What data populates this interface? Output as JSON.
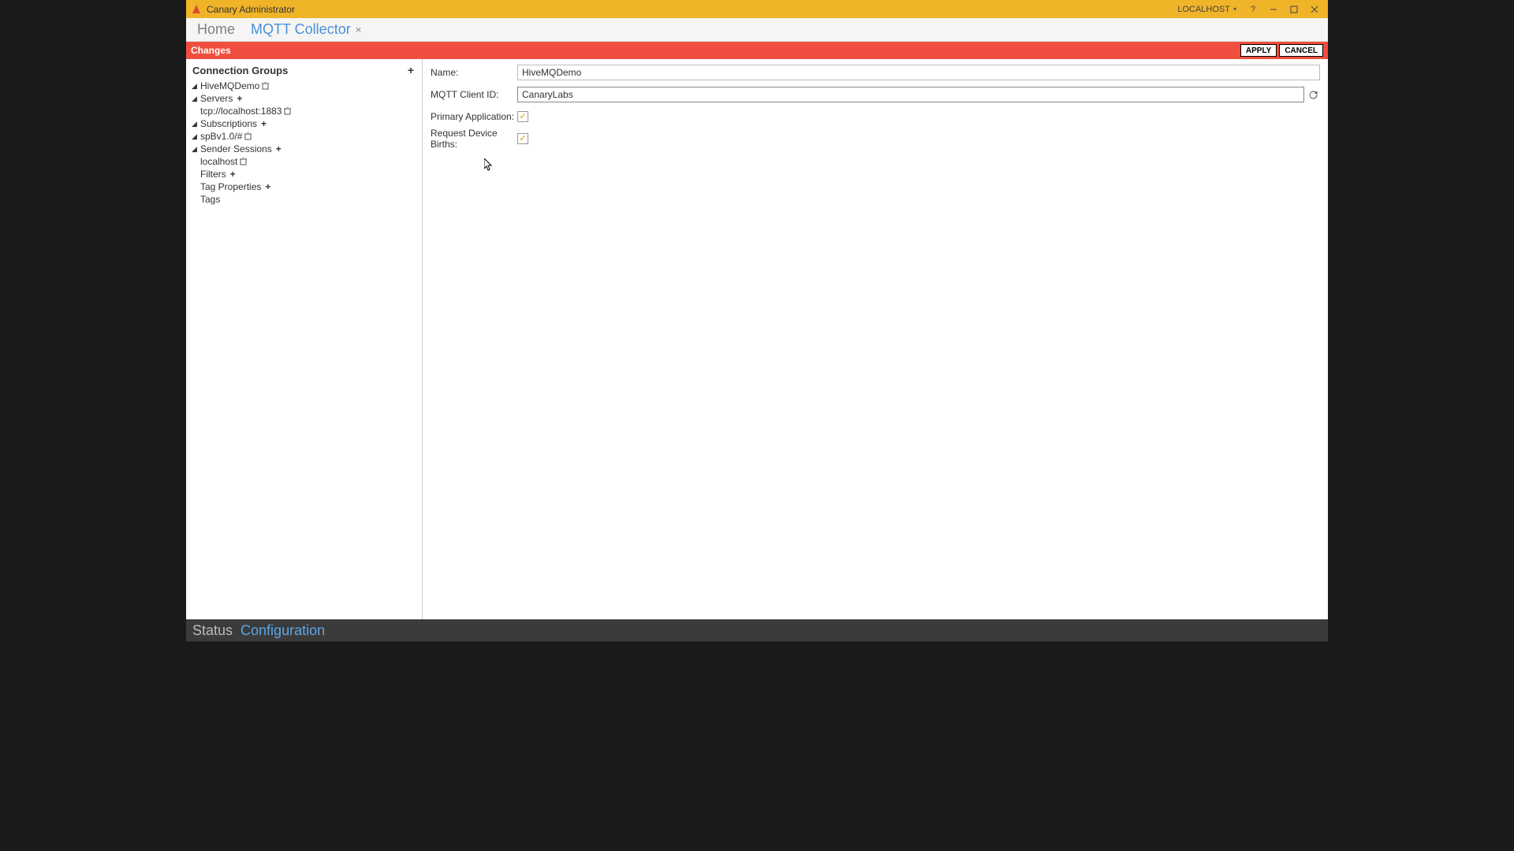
{
  "titlebar": {
    "title": "Canary Administrator",
    "host": "LOCALHOST"
  },
  "tabs": {
    "home": "Home",
    "active": "MQTT Collector"
  },
  "changes": {
    "label": "Changes",
    "apply": "APPLY",
    "cancel": "CANCEL"
  },
  "sidebar": {
    "header": "Connection Groups",
    "tree": {
      "group": "HiveMQDemo",
      "servers": "Servers",
      "server0": "tcp://localhost:1883",
      "subs": "Subscriptions",
      "topic": "spBv1.0/#",
      "sessions": "Sender Sessions",
      "session0": "localhost",
      "filters": "Filters",
      "tagprops": "Tag Properties",
      "tags": "Tags"
    }
  },
  "form": {
    "name_label": "Name:",
    "name_value": "HiveMQDemo",
    "clientid_label": "MQTT Client ID:",
    "clientid_value": "CanaryLabs",
    "primary_label": "Primary Application:",
    "rdb_label": "Request Device Births:"
  },
  "bottom": {
    "status": "Status",
    "config": "Configuration"
  }
}
